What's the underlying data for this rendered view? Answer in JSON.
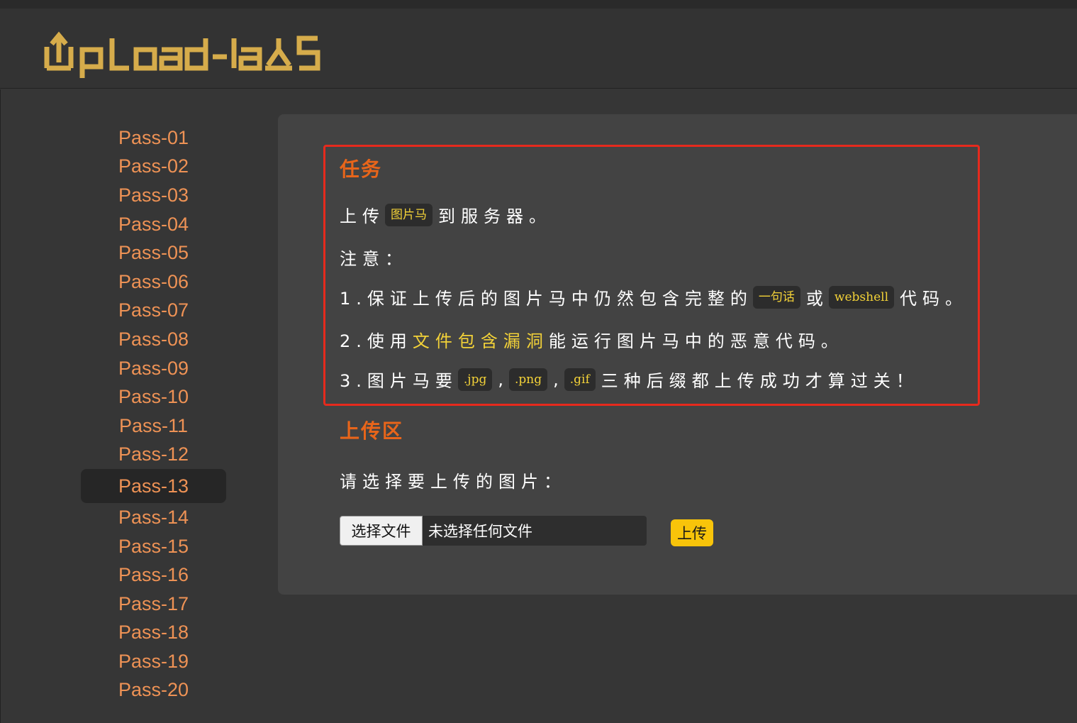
{
  "header": {
    "logo_text": "Upload-labs",
    "logo_color": "#d6ac4b"
  },
  "sidebar": {
    "items": [
      {
        "label": "Pass-01"
      },
      {
        "label": "Pass-02"
      },
      {
        "label": "Pass-03"
      },
      {
        "label": "Pass-04"
      },
      {
        "label": "Pass-05"
      },
      {
        "label": "Pass-06"
      },
      {
        "label": "Pass-07"
      },
      {
        "label": "Pass-08"
      },
      {
        "label": "Pass-09"
      },
      {
        "label": "Pass-10"
      },
      {
        "label": "Pass-11"
      },
      {
        "label": "Pass-12"
      },
      {
        "label": "Pass-13"
      },
      {
        "label": "Pass-14"
      },
      {
        "label": "Pass-15"
      },
      {
        "label": "Pass-16"
      },
      {
        "label": "Pass-17"
      },
      {
        "label": "Pass-18"
      },
      {
        "label": "Pass-19"
      },
      {
        "label": "Pass-20"
      }
    ],
    "active_index": 12
  },
  "task": {
    "title": "任务",
    "line1_a": "上传",
    "line1_code": "图片马",
    "line1_b": "到服务器。",
    "note": "注意：",
    "line2_a": "1.保证上传后的图片马中仍然包含完整的",
    "line2_code1": "一句话",
    "line2_mid": "或",
    "line2_code2": "webshell",
    "line2_b": "代码。",
    "line3_a": "2.使用",
    "line3_hl": "文件包含漏洞",
    "line3_b": "能运行图片马中的恶意代码。",
    "line4_a": "3.图片马要",
    "line4_code1": ".jpg",
    "line4_sep1": ",",
    "line4_code2": ".png",
    "line4_sep2": ",",
    "line4_code3": ".gif",
    "line4_b": "三种后缀都上传成功才算过关！"
  },
  "upload": {
    "title": "上传区",
    "prompt": "请选择要上传的图片：",
    "choose_label": "选择文件",
    "no_file_text": "未选择任何文件",
    "submit_label": "上传"
  },
  "colors": {
    "accent": "#e8651a",
    "highlight": "#f3d238",
    "border": "#e62a1d",
    "button": "#f8c40a",
    "nav_text": "#ee9255"
  }
}
